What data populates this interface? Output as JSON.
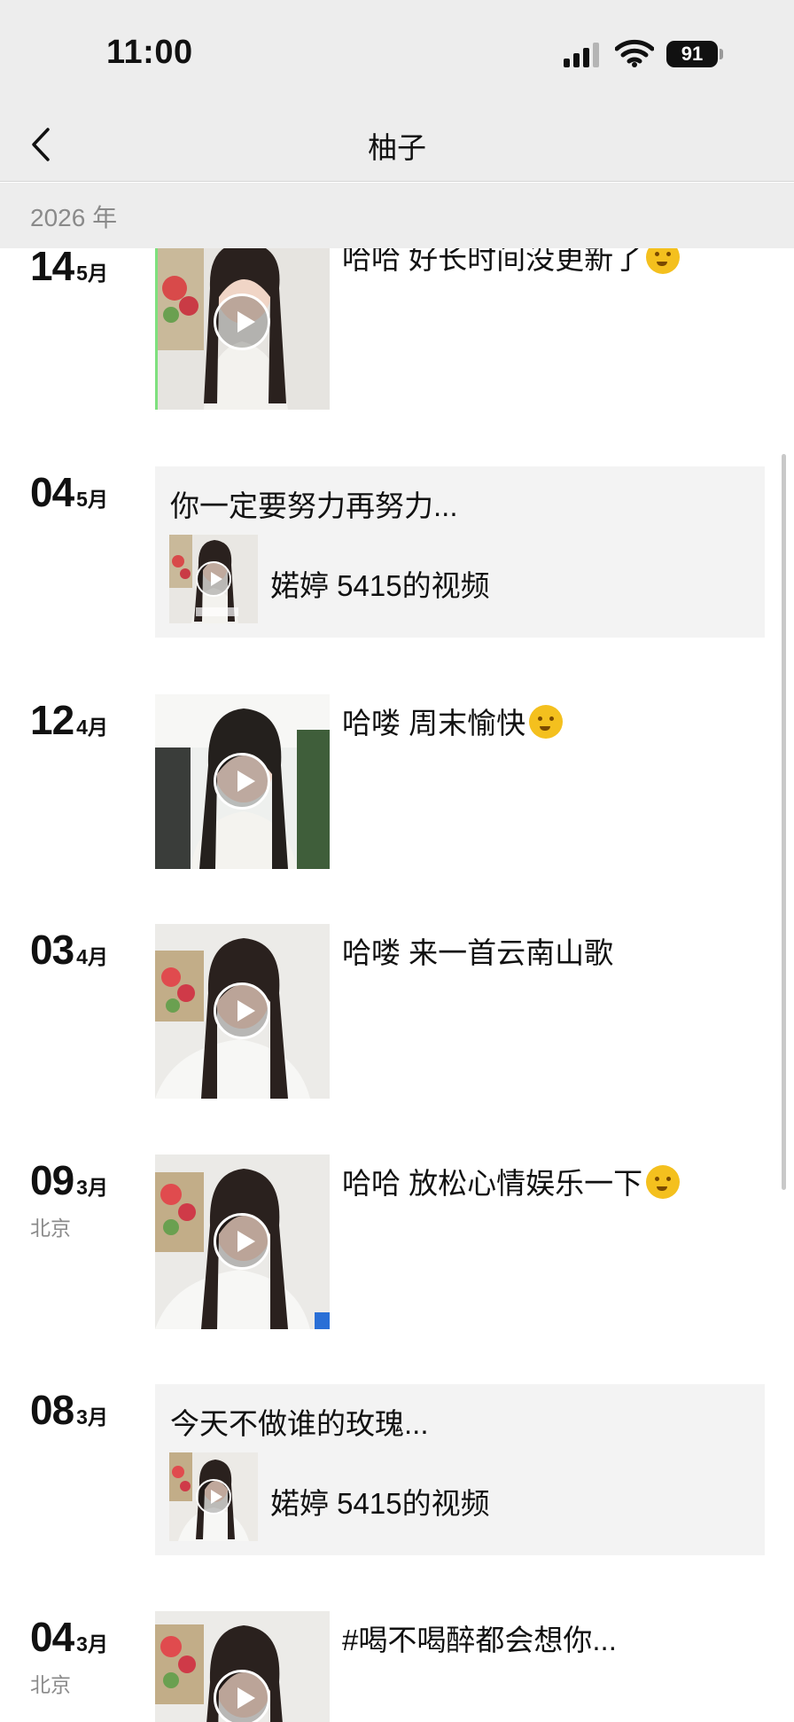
{
  "status": {
    "time": "11:00",
    "battery": "91"
  },
  "nav": {
    "title": "柚子"
  },
  "year": "2026 年",
  "posts": [
    {
      "day": "14",
      "month": "5月",
      "caption": "哈哈 好长时间没更新了",
      "emoji": "hand-over-mouth"
    },
    {
      "day": "04",
      "month": "5月",
      "share_title": "你一定要努力再努力...",
      "share_label": "婼婷 5415的视频"
    },
    {
      "day": "12",
      "month": "4月",
      "caption": "哈喽 周末愉快",
      "emoji": "kissing-face"
    },
    {
      "day": "03",
      "month": "4月",
      "caption": "哈喽 来一首云南山歌"
    },
    {
      "day": "09",
      "month": "3月",
      "location": "北京",
      "caption": "哈哈 放松心情娱乐一下",
      "emoji": "rolling-laughing"
    },
    {
      "day": "08",
      "month": "3月",
      "share_title": "今天不做谁的玫瑰...",
      "share_label": "婼婷 5415的视频"
    },
    {
      "day": "04",
      "month": "3月",
      "location": "北京",
      "caption": "#喝不喝醉都会想你..."
    }
  ],
  "colors": {
    "header_bg": "#ededed",
    "card_bg": "#f3f3f3",
    "meta_gray": "#8a8a8a"
  }
}
